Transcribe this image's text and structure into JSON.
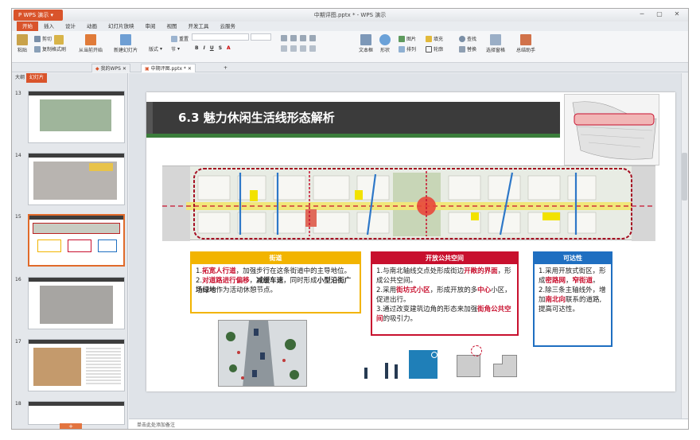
{
  "app": {
    "brand": "WPS 演示",
    "doc_title": "中期评图.pptx * - WPS 演示",
    "controls": [
      "─",
      "▢",
      "✕"
    ]
  },
  "menu_tabs": [
    "开始",
    "插入",
    "设计",
    "动画",
    "幻灯片放映",
    "审阅",
    "视图",
    "开发工具",
    "云服务"
  ],
  "active_menu_tab": "开始",
  "ribbon": {
    "paste": "粘贴",
    "cut": "剪切",
    "copy": "复制",
    "format_painter": "格式刷",
    "from_current": "从当前开始",
    "new_slide": "新建幻灯片",
    "layout": "版式",
    "section": "节",
    "reset": "重置",
    "textbox": "文本框",
    "shape": "形状",
    "arrange": "排列",
    "picture": "图片",
    "fill": "填充",
    "outline": "轮廓",
    "find": "查找",
    "replace": "替换",
    "select_pane": "选择窗格",
    "assistant": "总结助手"
  },
  "doc_tabs": [
    "我的WPS",
    "中期评图.pptx *"
  ],
  "left_pane": {
    "tabs": [
      "大纲",
      "幻灯片"
    ],
    "active_tab": "幻灯片",
    "thumb_numbers": [
      "13",
      "14",
      "15",
      "16",
      "17",
      "18"
    ],
    "selected": "15"
  },
  "notes_placeholder": "单击此处添加备注",
  "slide": {
    "title": "6.3 魅力休闲生活线形态解析",
    "box1": {
      "header": "街道",
      "p1_pre": "1.",
      "p1_red": "拓宽人行道",
      "p1_rest": "，加强步行在这条街道中的主导地位。",
      "p2_pre": "2.",
      "p2_red": "对道路进行偏移",
      "p2_mid": "，",
      "p2_bold1": "减缓车速",
      "p2_rest": "，同时形成",
      "p2_bold2": "小型沿街广场绿地",
      "p2_end": "作为活动休憩节点。"
    },
    "box2": {
      "header": "开放公共空间",
      "p1_pre": "1.与南北轴线交点处形成街边",
      "p1_red": "开敞的界面",
      "p1_rest": "，形成公共空间。",
      "p2_pre": "2.采用",
      "p2_red": "街坊式小区",
      "p2_mid": "，形成开放的多",
      "p2_red2": "中心",
      "p2_rest": "小区，促进出行。",
      "p3_pre": "3.通过改变建筑边角的形态来加强",
      "p3_red": "街角公共空间",
      "p3_rest": "的吸引力。"
    },
    "box3": {
      "header": "可达性",
      "p1_pre": "1.采用开放式街区，形成",
      "p1_red": "密路网",
      "p1_mid": "，",
      "p1_red2": "窄街道",
      "p1_end": "。",
      "p2_pre": "2.除三条主轴线外，增加",
      "p2_red": "南北向",
      "p2_rest": "联系的道路,提高可达性。"
    }
  },
  "colors": {
    "brand_orange": "#d9542b",
    "box1_border": "#f2b400",
    "box2_border": "#c8102e",
    "box3_border": "#1f6fc1",
    "red_text": "#c8102e"
  }
}
